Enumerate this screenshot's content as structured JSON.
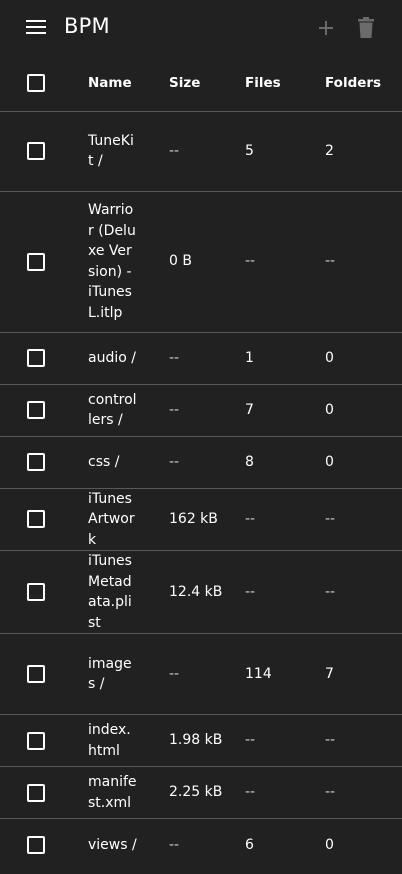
{
  "app": {
    "title": "BPM",
    "menu_icon": "menu-icon",
    "add_icon": "add-icon",
    "delete_icon": "delete-icon"
  },
  "table": {
    "headers": {
      "name": "Name",
      "size": "Size",
      "files": "Files",
      "folders": "Folders"
    },
    "rows": [
      {
        "name": "TuneKit /",
        "size": "--",
        "files": "5",
        "folders": "2"
      },
      {
        "name": "Warrior (Deluxe Version) - iTunesL.itlp",
        "size": "0 B",
        "files": "--",
        "folders": "--"
      },
      {
        "name": "audio /",
        "size": "--",
        "files": "1",
        "folders": "0"
      },
      {
        "name": "controllers /",
        "size": "--",
        "files": "7",
        "folders": "0"
      },
      {
        "name": "css /",
        "size": "--",
        "files": "8",
        "folders": "0"
      },
      {
        "name": "iTunesArtwork",
        "size": "162 kB",
        "files": "--",
        "folders": "--"
      },
      {
        "name": "iTunesMetadata.plist",
        "size": "12.4 kB",
        "files": "--",
        "folders": "--"
      },
      {
        "name": "images /",
        "size": "--",
        "files": "114",
        "folders": "7"
      },
      {
        "name": "index.html",
        "size": "1.98 kB",
        "files": "--",
        "folders": "--"
      },
      {
        "name": "manifest.xml",
        "size": "2.25 kB",
        "files": "--",
        "folders": "--"
      },
      {
        "name": "views /",
        "size": "--",
        "files": "6",
        "folders": "0"
      }
    ]
  }
}
